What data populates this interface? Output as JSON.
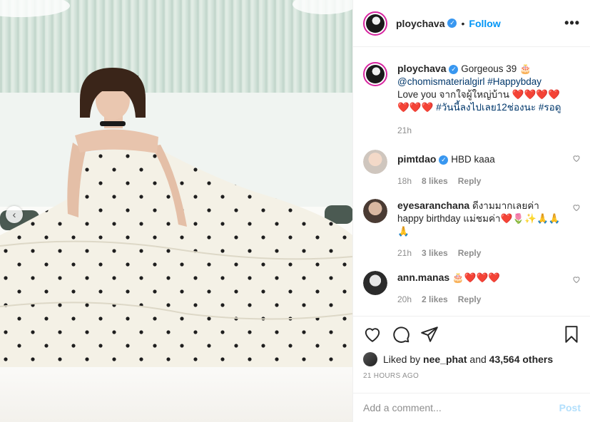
{
  "post": {
    "author": "ploychava",
    "verified": true,
    "follow_label": "Follow",
    "separator": "•",
    "more_label": "•••",
    "carousel_prev": "‹"
  },
  "caption": {
    "username": "ploychava",
    "line1": "Gorgeous 39 🎂",
    "mention": "@chomismaterialgirl",
    "hashtag1": "#Happybday",
    "line3": "Love you จากใจผู้ใหญ่บ้าน ❤️❤️❤️❤️",
    "line4_hearts": "❤️❤️❤️",
    "hashtag2": "#วันนี้ลงไปเลย12ช่องนะ",
    "hashtag3": "#รอดู",
    "time": "21h"
  },
  "comments": [
    {
      "username": "pimtdao",
      "verified": true,
      "text": "HBD kaaa",
      "time": "18h",
      "likes": "8 likes",
      "reply": "Reply"
    },
    {
      "username": "eyesaranchana",
      "verified": false,
      "text": "ดีงามมากเลยค่า happy birthday แม่ชมค่า❤️🌷✨🙏🙏🙏",
      "time": "21h",
      "likes": "3 likes",
      "reply": "Reply"
    },
    {
      "username": "ann.manas",
      "verified": false,
      "text": "🎂❤️❤️❤️",
      "time": "20h",
      "likes": "2 likes",
      "reply": "Reply"
    }
  ],
  "engagement": {
    "liked_by_prefix": "Liked by",
    "liked_by_user": "nee_phat",
    "liked_by_and": "and",
    "others": "43,564 others",
    "timestamp": "21 HOURS AGO"
  },
  "comment_box": {
    "placeholder": "Add a comment...",
    "post_label": "Post"
  },
  "colors": {
    "link": "#0095f6",
    "verified": "#3897f0",
    "heart": "#e0245e"
  },
  "icons": [
    "heart-icon",
    "comment-icon",
    "share-icon",
    "bookmark-icon",
    "verified-icon",
    "more-options-icon",
    "chevron-left-icon"
  ]
}
